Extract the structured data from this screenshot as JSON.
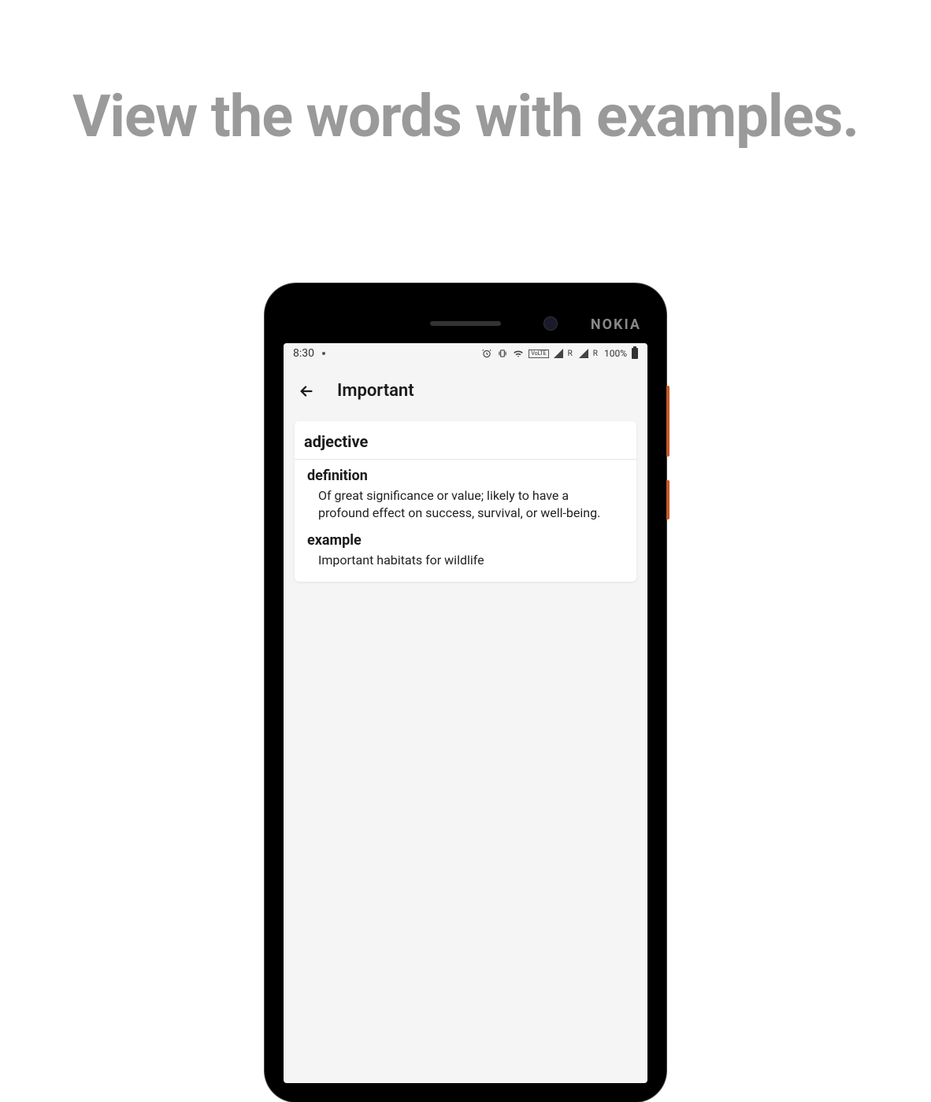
{
  "headline": "View the words with examples.",
  "phone": {
    "brand": "NOKIA"
  },
  "status_bar": {
    "time": "8:30",
    "battery_pct": "100%",
    "roaming_label": "R"
  },
  "header": {
    "title": "Important"
  },
  "card": {
    "part_of_speech": "adjective",
    "definition_label": "definition",
    "definition_text": "Of great significance or value; likely to have a profound effect on success, survival, or well-being.",
    "example_label": "example",
    "example_text": "Important habitats for wildlife"
  }
}
